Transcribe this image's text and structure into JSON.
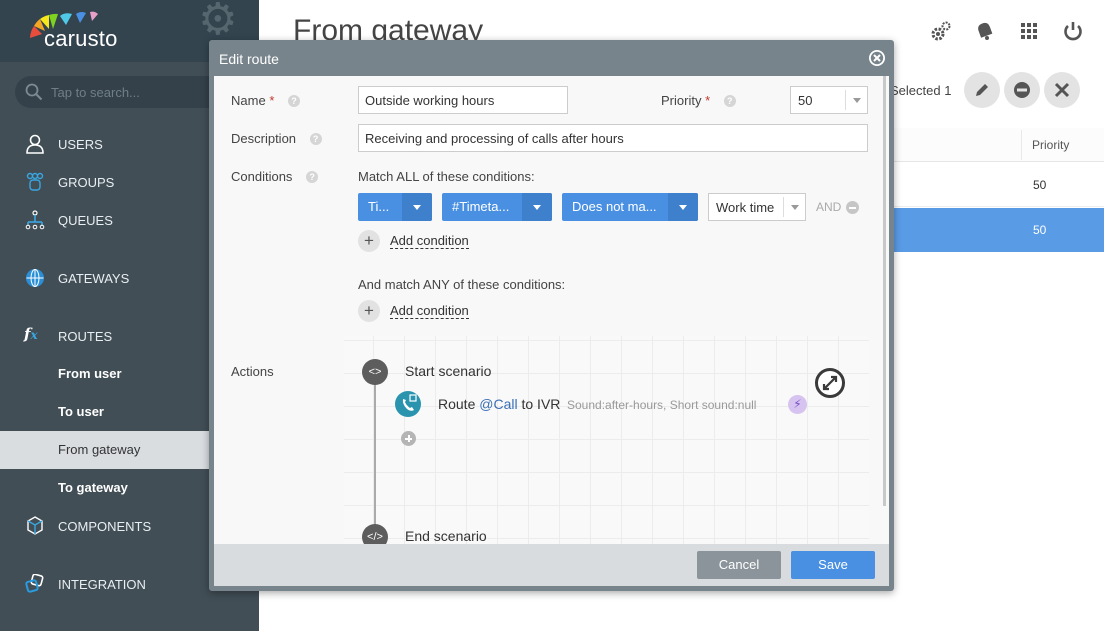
{
  "app": {
    "brand": "carusto"
  },
  "search": {
    "placeholder": "Tap to search..."
  },
  "sidebar": {
    "items": [
      {
        "label": "USERS",
        "icon": "user-icon"
      },
      {
        "label": "GROUPS",
        "icon": "groups-icon"
      },
      {
        "label": "QUEUES",
        "icon": "queues-icon"
      },
      {
        "label": "GATEWAYS",
        "icon": "globe-icon"
      },
      {
        "label": "ROUTES",
        "icon": "fx-icon"
      },
      {
        "label": "COMPONENTS",
        "icon": "cube-icon"
      },
      {
        "label": "INTEGRATION",
        "icon": "integration-icon"
      }
    ],
    "routes_sub": [
      {
        "label": "From user",
        "active": false
      },
      {
        "label": "To user",
        "active": false
      },
      {
        "label": "From gateway",
        "active": true
      },
      {
        "label": "To gateway",
        "active": false
      }
    ]
  },
  "page": {
    "title": "From gateway",
    "selected_text": "Selected 1",
    "table": {
      "columns": [
        "Priority"
      ],
      "rows": [
        {
          "priority": "50",
          "selected": false
        },
        {
          "priority": "50",
          "selected": true
        }
      ]
    },
    "accent_color": "#5a9be6"
  },
  "modal": {
    "title": "Edit route",
    "fields": {
      "name_label": "Name",
      "name_value": "Outside working hours",
      "priority_label": "Priority",
      "priority_value": "50",
      "description_label": "Description",
      "description_value": "Receiving and processing of calls after hours",
      "conditions_label": "Conditions",
      "actions_label": "Actions",
      "required_mark": "*",
      "help_glyph": "?"
    },
    "conditions": {
      "match_all_label": "Match ALL of these conditions:",
      "match_any_label": "And match ANY of these conditions:",
      "row": {
        "field": "Ti...",
        "source": "#Timeta...",
        "operator": "Does not ma...",
        "value": "Work time",
        "joiner": "AND"
      },
      "add_condition_label": "Add condition"
    },
    "scenario": {
      "start_label": "Start scenario",
      "end_label": "End scenario",
      "start_glyph": "<>",
      "end_glyph": "</>",
      "action": {
        "verb": "Route",
        "variable": "@Call",
        "target": "to IVR",
        "meta": "Sound:after-hours, Short sound:null"
      }
    },
    "buttons": {
      "cancel": "Cancel",
      "save": "Save"
    }
  }
}
